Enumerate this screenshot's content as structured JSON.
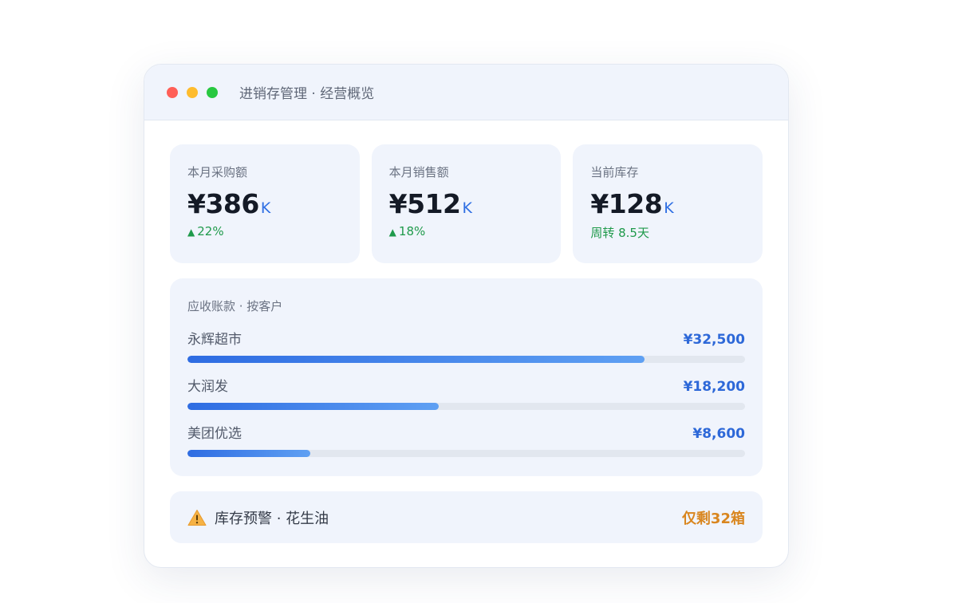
{
  "window": {
    "title": "进销存管理 · 经营概览"
  },
  "stats": [
    {
      "label": "本月采购额",
      "value": "¥386",
      "unit": "K",
      "trend_arrow": "▲",
      "trend_text": "22%"
    },
    {
      "label": "本月销售额",
      "value": "¥512",
      "unit": "K",
      "trend_arrow": "▲",
      "trend_text": "18%"
    },
    {
      "label": "当前库存",
      "value": "¥128",
      "unit": "K",
      "trend_arrow": "",
      "trend_text": "周转 8.5天"
    }
  ],
  "receivables": {
    "title": "应收账款 · 按客户",
    "rows": [
      {
        "name": "永辉超市",
        "amount": "¥32,500",
        "progress_fraction": 0.82
      },
      {
        "name": "大润发",
        "amount": "¥18,200",
        "progress_fraction": 0.45
      },
      {
        "name": "美团优选",
        "amount": "¥8,600",
        "progress_fraction": 0.22
      }
    ]
  },
  "alert": {
    "icon": "warning-icon",
    "text": "库存预警 · 花生油",
    "status": "仅剩32箱"
  },
  "colors": {
    "accent": "#2e6ce2",
    "positive": "#1f9a4b",
    "warning": "#d9861f",
    "card_bg": "#f0f4fc"
  }
}
